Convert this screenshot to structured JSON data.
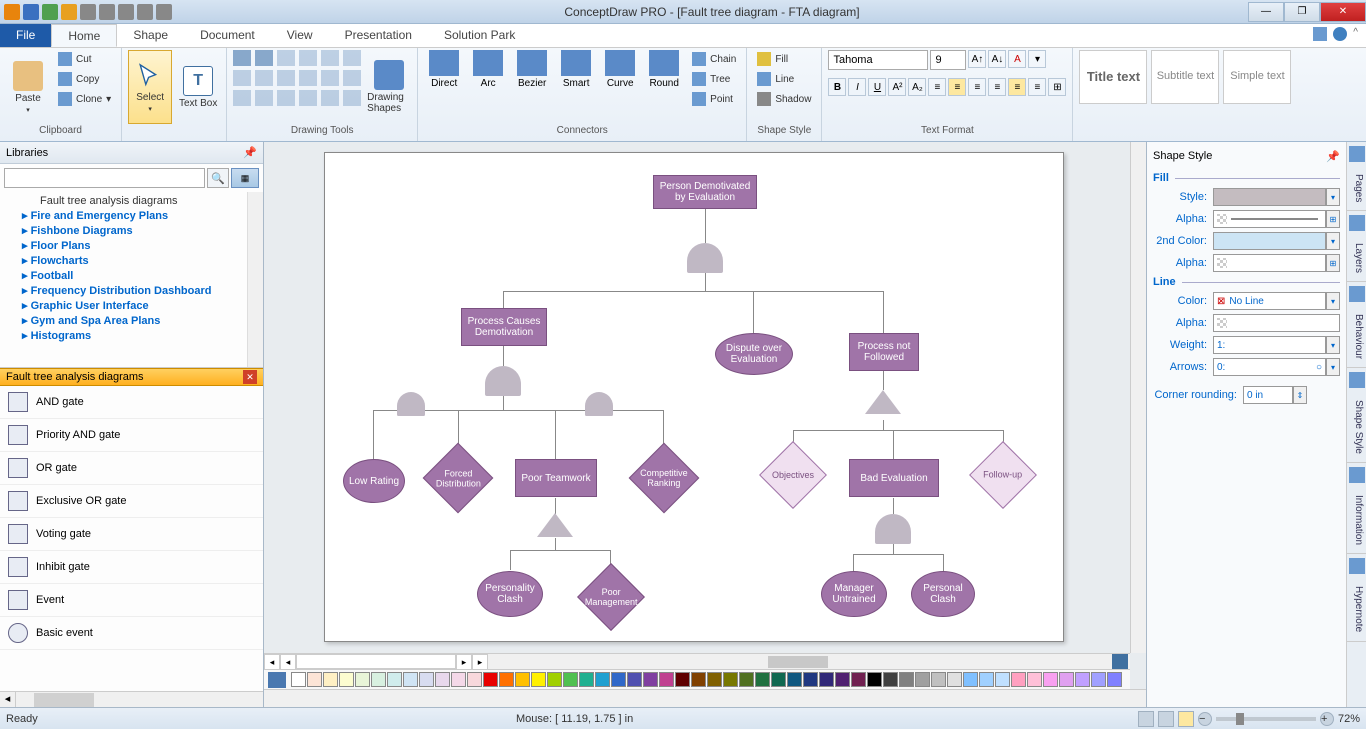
{
  "titlebar": {
    "title": "ConceptDraw PRO - [Fault tree diagram - FTA diagram]"
  },
  "tabs": {
    "file": "File",
    "items": [
      "Home",
      "Shape",
      "Document",
      "View",
      "Presentation",
      "Solution Park"
    ],
    "active": 0
  },
  "ribbon": {
    "clipboard": {
      "paste": "Paste",
      "cut": "Cut",
      "copy": "Copy",
      "clone": "Clone",
      "label": "Clipboard"
    },
    "select": "Select",
    "textbox": "Text Box",
    "drawing": {
      "shapes": "Drawing Shapes",
      "label": "Drawing Tools"
    },
    "connectors": {
      "direct": "Direct",
      "arc": "Arc",
      "bezier": "Bezier",
      "smart": "Smart",
      "curve": "Curve",
      "round": "Round",
      "chain": "Chain",
      "tree": "Tree",
      "point": "Point",
      "label": "Connectors"
    },
    "shapestyle": {
      "fill": "Fill",
      "line": "Line",
      "shadow": "Shadow",
      "label": "Shape Style"
    },
    "textformat": {
      "font": "Tahoma",
      "size": "9",
      "label": "Text Format"
    },
    "presets": {
      "title": "Title text",
      "subtitle": "Subtitle text",
      "simple": "Simple text"
    }
  },
  "libraries": {
    "header": "Libraries",
    "tree": [
      "Fault tree analysis diagrams",
      "Fire and Emergency Plans",
      "Fishbone Diagrams",
      "Floor Plans",
      "Flowcharts",
      "Football",
      "Frequency Distribution Dashboard",
      "Graphic User Interface",
      "Gym and Spa Area Plans",
      "Histograms"
    ],
    "shapes_header": "Fault tree analysis diagrams",
    "shapes": [
      "AND gate",
      "Priority AND gate",
      "OR gate",
      "Exclusive OR gate",
      "Voting gate",
      "Inhibit gate",
      "Event",
      "Basic event"
    ]
  },
  "diagram": {
    "n1": "Person Demotivated by Evaluation",
    "n2": "Process Causes Demotivation",
    "n3": "Dispute over Evaluation",
    "n4": "Process not Followed",
    "n5": "Low Rating",
    "n6": "Forced Distribution",
    "n7": "Poor Teamwork",
    "n8": "Competitive Ranking",
    "n9": "Objectives",
    "n10": "Bad Evaluation",
    "n11": "Follow-up",
    "n12": "Personality Clash",
    "n13": "Poor Management",
    "n14": "Manager Untrained",
    "n15": "Personal Clash"
  },
  "shapestyle_panel": {
    "header": "Shape Style",
    "fill": "Fill",
    "style": "Style:",
    "alpha": "Alpha:",
    "second": "2nd Color:",
    "line": "Line",
    "color": "Color:",
    "noline": "No Line",
    "weight": "Weight:",
    "weightval": "1:",
    "arrows": "Arrows:",
    "arrowsval": "0:",
    "corner": "Corner rounding:",
    "cornerval": "0 in"
  },
  "sidetabs": [
    "Pages",
    "Layers",
    "Behaviour",
    "Shape Style",
    "Information",
    "Hypernote"
  ],
  "status": {
    "ready": "Ready",
    "mouse": "Mouse: [ 11.19, 1.75 ] in",
    "zoom": "72%"
  },
  "colors": [
    "#ffffff",
    "#fce4d6",
    "#fff0c4",
    "#fcfcd0",
    "#e8f4d8",
    "#d8f0e0",
    "#d0ecec",
    "#d0e4f4",
    "#d8dcf0",
    "#e8d8ec",
    "#f4d8e8",
    "#f8d8dc",
    "#e80000",
    "#ff7000",
    "#ffc000",
    "#fff000",
    "#a0d000",
    "#50c050",
    "#20b090",
    "#20a0d0",
    "#3068c8",
    "#5050b0",
    "#8040a0",
    "#c04090",
    "#600000",
    "#804000",
    "#806000",
    "#787800",
    "#507020",
    "#207040",
    "#106850",
    "#105880",
    "#203880",
    "#302878",
    "#502070",
    "#702050",
    "#000000",
    "#404040",
    "#808080",
    "#a0a0a0",
    "#c0c0c0",
    "#e0e0e0",
    "#80c0ff",
    "#a0d0ff",
    "#c0e0ff",
    "#ffa0c0",
    "#ffc0d8",
    "#f8a0f0",
    "#e0a0f0",
    "#c0a0ff",
    "#a0a0ff",
    "#8080ff"
  ]
}
